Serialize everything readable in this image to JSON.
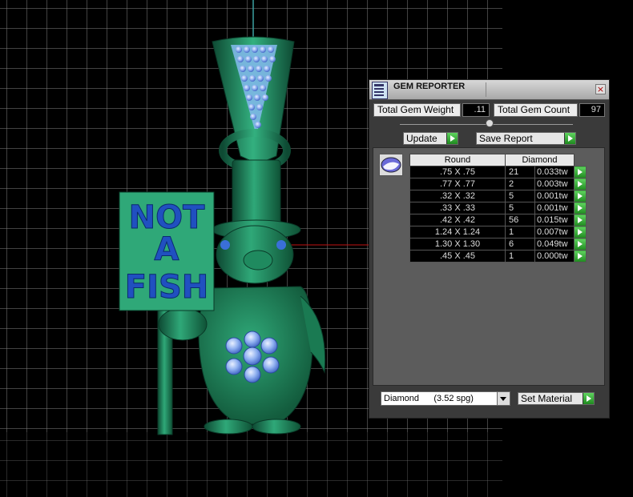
{
  "panel": {
    "title": "GEM REPORTER",
    "close_glyph": "×",
    "total_weight_label": "Total Gem Weight",
    "total_weight_value": ".11",
    "total_count_label": "Total Gem Count",
    "total_count_value": "97",
    "update_label": "Update",
    "save_report_label": "Save Report",
    "table": {
      "shape_header": "Round",
      "material_header": "Diamond",
      "rows": [
        {
          "size": ".75 X .75",
          "count": "21",
          "weight": "0.033tw"
        },
        {
          "size": ".77 X .77",
          "count": "2",
          "weight": "0.003tw"
        },
        {
          "size": ".32 X .32",
          "count": "5",
          "weight": "0.001tw"
        },
        {
          "size": ".33 X .33",
          "count": "5",
          "weight": "0.001tw"
        },
        {
          "size": ".42 X .42",
          "count": "56",
          "weight": "0.015tw"
        },
        {
          "size": "1.24 X 1.24",
          "count": "1",
          "weight": "0.007tw"
        },
        {
          "size": "1.30 X 1.30",
          "count": "6",
          "weight": "0.049tw"
        },
        {
          "size": ".45 X .45",
          "count": "1",
          "weight": "0.000tw"
        }
      ]
    },
    "material_select_value": "Diamond      (3.52 spg)",
    "set_material_label": "Set Material"
  },
  "model": {
    "sign_lines": [
      "NOT",
      "A",
      "FISH"
    ]
  },
  "colors": {
    "model_green": "#1f7a55",
    "model_green_light": "#2fa878",
    "gem_blue": "#3a6fd8",
    "button_green": "#2fa82f",
    "panel_bg": "#3a3a3a"
  }
}
